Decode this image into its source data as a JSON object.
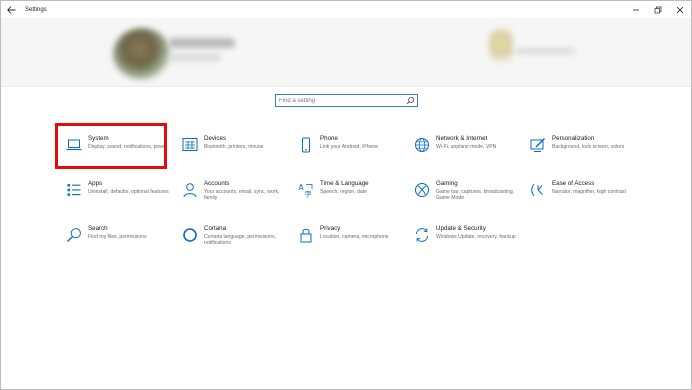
{
  "window": {
    "title": "Settings",
    "controls": {
      "minimize_icon": "minimize-icon",
      "maximize_icon": "restore-icon",
      "close_icon": "close-icon"
    }
  },
  "search": {
    "placeholder": "Find a setting",
    "value": ""
  },
  "colors": {
    "accent": "#0a6cc2",
    "highlight": "#e00d0d"
  },
  "tiles": [
    {
      "title": "System",
      "desc": "Display, sound, notifications, power",
      "icon": "laptop-icon",
      "highlighted": true
    },
    {
      "title": "Devices",
      "desc": "Bluetooth, printers, mouse",
      "icon": "keyboard-icon"
    },
    {
      "title": "Phone",
      "desc": "Link your Android, iPhone",
      "icon": "phone-icon"
    },
    {
      "title": "Network & Internet",
      "desc": "Wi-Fi, airplane mode, VPN",
      "icon": "globe-icon"
    },
    {
      "title": "Personalization",
      "desc": "Background, lock screen, colors",
      "icon": "paintbrush-icon"
    },
    {
      "title": "Apps",
      "desc": "Uninstall, defaults, optional features",
      "icon": "apps-list-icon"
    },
    {
      "title": "Accounts",
      "desc": "Your accounts, email, sync, work, family",
      "icon": "person-icon"
    },
    {
      "title": "Time & Language",
      "desc": "Speech, region, date",
      "icon": "time-language-icon"
    },
    {
      "title": "Gaming",
      "desc": "Game bar, captures, broadcasting, Game Mode",
      "icon": "xbox-icon"
    },
    {
      "title": "Ease of Access",
      "desc": "Narrator, magnifier, high contrast",
      "icon": "ease-of-access-icon"
    },
    {
      "title": "Search",
      "desc": "Find my files, permissions",
      "icon": "search-icon"
    },
    {
      "title": "Cortana",
      "desc": "Cortana language, permissions, notifications",
      "icon": "cortana-icon"
    },
    {
      "title": "Privacy",
      "desc": "Location, camera, microphone",
      "icon": "lock-icon"
    },
    {
      "title": "Update & Security",
      "desc": "Windows Update, recovery, backup",
      "icon": "sync-icon"
    }
  ]
}
